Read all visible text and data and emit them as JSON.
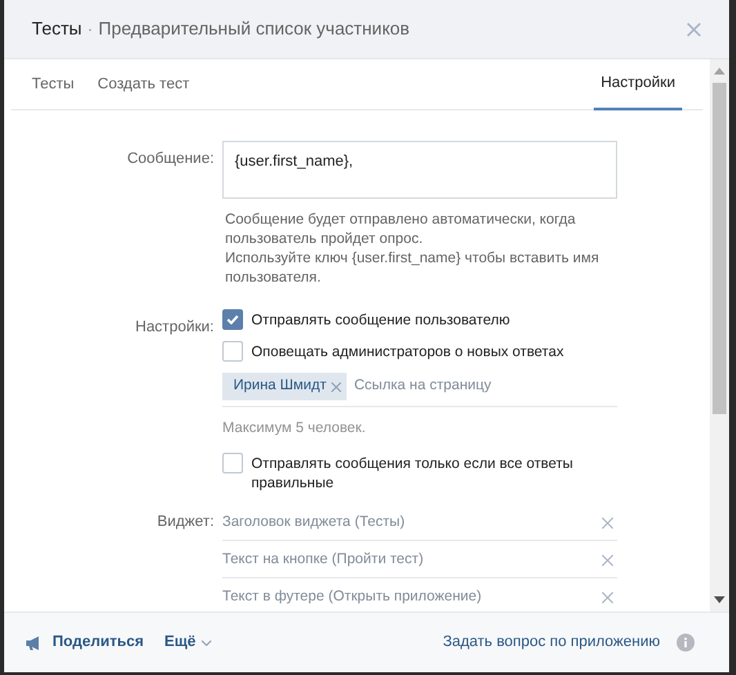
{
  "window": {
    "title": "Тесты",
    "separator": "·",
    "subtitle": "Предварительный список участников"
  },
  "tabs": [
    {
      "label": "Тесты",
      "selected": false
    },
    {
      "label": "Создать тест",
      "selected": false
    },
    {
      "label": "Настройки",
      "selected": true
    }
  ],
  "message": {
    "label": "Сообщение:",
    "value": "{user.first_name},",
    "help": "Сообщение будет отправлено автоматически, когда пользователь пройдет опрос.",
    "help_2": "Используйте ключ {user.first_name} чтобы вставить имя пользователя."
  },
  "settings": {
    "label": "Настройки:",
    "options": [
      {
        "kind": "checkbox",
        "label": "Отправлять сообщение пользователю",
        "checked": true
      },
      {
        "kind": "checkbox",
        "label": "Оповещать администраторов о новых ответах",
        "checked": false
      },
      {
        "kind": "people",
        "tags": [
          "Ирина Шмидт"
        ],
        "placeholder": "Ссылка на страницу",
        "hint": "Максимум 5 человек."
      },
      {
        "kind": "checkbox",
        "label": "Отправлять сообщения только если все ответы правильные",
        "checked": false
      }
    ]
  },
  "widget": {
    "label": "Виджет:",
    "fields": [
      {
        "placeholder": "Заголовок виджета (Тесты)"
      },
      {
        "placeholder": "Текст на кнопке (Пройти тест)"
      },
      {
        "placeholder": "Текст в футере (Открыть приложение)"
      }
    ]
  },
  "footer": {
    "share": "Поделиться",
    "more": "Ещё",
    "ask": "Задать вопрос по приложению"
  }
}
